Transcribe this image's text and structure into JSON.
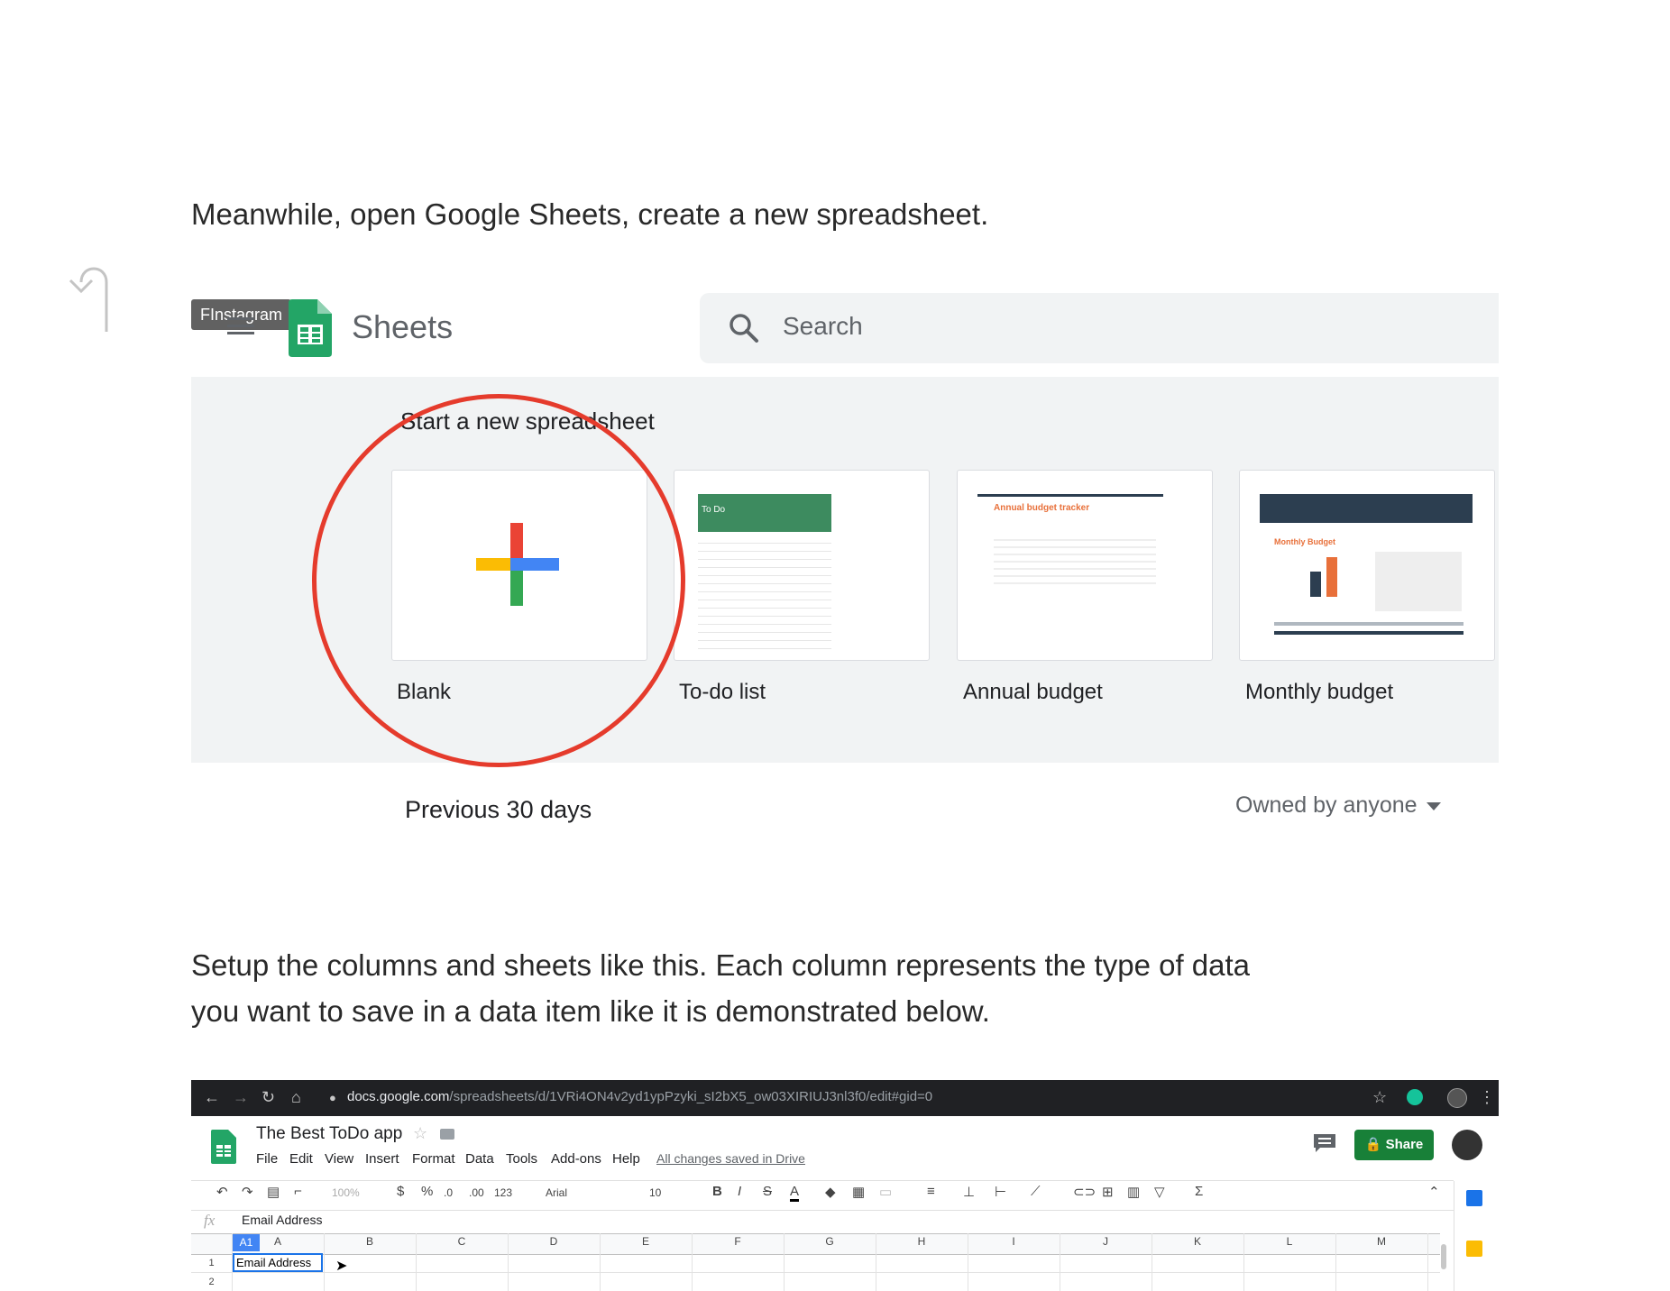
{
  "article": {
    "para1": "Meanwhile, open Google Sheets, create a new spreadsheet.",
    "para2_line1": "Setup the columns and sheets like this. Each column represents the type of data",
    "para2_line2": "you want to save in a data item like it is demonstrated below."
  },
  "sheets_home": {
    "tooltip": "FInstagram",
    "app_name": "Sheets",
    "search_placeholder": "Search",
    "templates_heading": "Start a new spreadsheet",
    "templates": [
      {
        "label": "Blank"
      },
      {
        "label": "To-do list",
        "thumb_title": "To Do"
      },
      {
        "label": "Annual budget",
        "thumb_title": "Annual budget tracker"
      },
      {
        "label": "Monthly budget",
        "thumb_title": "Monthly Budget"
      }
    ],
    "recent_label": "Previous 30 days",
    "owner_filter": "Owned by anyone"
  },
  "spreadsheet": {
    "url_host": "docs.google.com",
    "url_path": "/spreadsheets/d/1VRi4ON4v2yd1ypPzyki_sI2bX5_ow03XIRIUJ3nl3f0/edit#gid=0",
    "doc_title": "The Best ToDo app",
    "menus": [
      "File",
      "Edit",
      "View",
      "Insert",
      "Format",
      "Data",
      "Tools",
      "Add-ons",
      "Help"
    ],
    "saved_status": "All changes saved in Drive",
    "share_label": "Share",
    "toolbar": {
      "zoom": "100%",
      "currency": "$",
      "percent": "%",
      "dec_less": ".0",
      "dec_more": ".00",
      "format": "123",
      "font": "Arial",
      "font_size": "10",
      "bold": "B",
      "italic": "I",
      "strike": "S",
      "text_color": "A"
    },
    "fx_label": "fx",
    "formula_value": "Email Address",
    "active_cell": "A1",
    "columns": [
      "A",
      "B",
      "C",
      "D",
      "E",
      "F",
      "G",
      "H",
      "I",
      "J",
      "K",
      "L",
      "M"
    ],
    "rows": [
      "1",
      "2"
    ],
    "a1_value": "Email Address"
  }
}
